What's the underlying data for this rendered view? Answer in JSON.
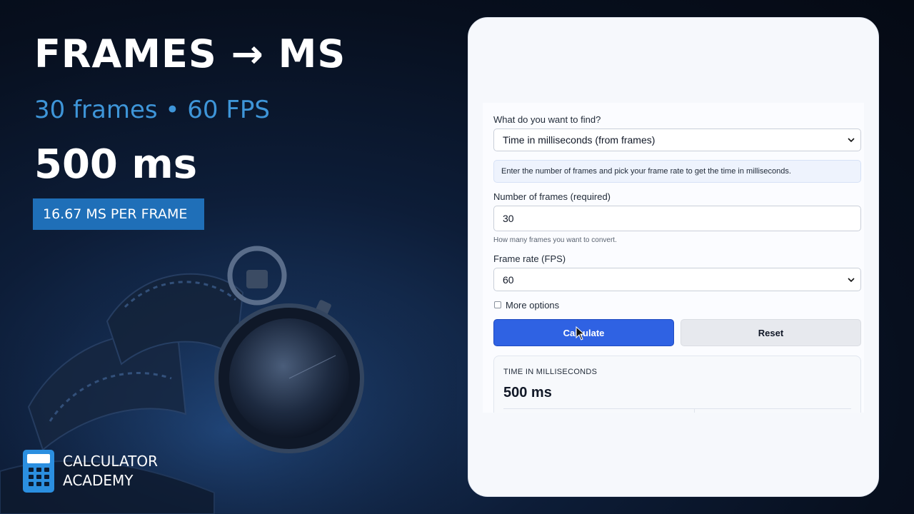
{
  "hero": {
    "title": "FRAMES → MS",
    "subtitle": "30 frames • 60 FPS",
    "result": "500 ms",
    "badge": "16.67 MS PER FRAME"
  },
  "brand": {
    "line1": "CALCULATOR",
    "line2": "ACADEMY",
    "icon": "calculator-icon"
  },
  "form": {
    "find_label": "What do you want to find?",
    "find_value": "Time in milliseconds (from frames)",
    "info_text": "Enter the number of frames and pick your frame rate to get the time in milliseconds.",
    "frames_label": "Number of frames (required)",
    "frames_value": "30",
    "frames_hint": "How many frames you want to convert.",
    "fps_label": "Frame rate (FPS)",
    "fps_value": "60",
    "more_options_label": "More options",
    "calculate_label": "Calculate",
    "reset_label": "Reset"
  },
  "result": {
    "label": "TIME IN MILLISECONDS",
    "value": "500 ms"
  },
  "colors": {
    "accent": "#3e95d8",
    "badge": "#1f6fb8",
    "primary_button": "#2f62e3"
  }
}
